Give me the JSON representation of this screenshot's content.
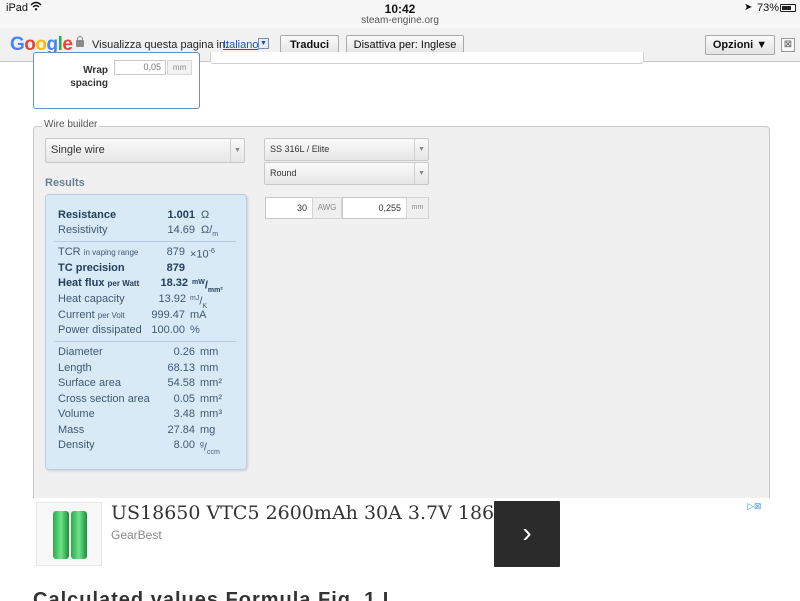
{
  "status_bar": {
    "device": "iPad",
    "time": "10:42",
    "url": "steam-engine.org",
    "battery": "73%",
    "battery_level": 0.73,
    "icons": [
      "wifi-icon",
      "location-arrow-icon",
      "battery-icon"
    ]
  },
  "translate_bar": {
    "logo": [
      "G",
      "o",
      "o",
      "g",
      "l",
      "e"
    ],
    "prompt": "Visualizza questa pagina in:",
    "language": "Italiano",
    "translate_button": "Traduci",
    "disable_button": "Disattiva per: Inglese",
    "options_button": "Opzioni ▼",
    "close_glyph": "⊠"
  },
  "coil": {
    "wrap_label": "Wrap spacing",
    "wrap_value": "0,05",
    "wrap_unit": "mm"
  },
  "wire_builder": {
    "legend": "Wire builder",
    "wire_type": "Single wire",
    "material": "SS 316L / Elite",
    "profile": "Round",
    "gauge": "30",
    "gauge_unit": "AWG",
    "diameter": "0,255",
    "diameter_unit": "mm",
    "results_title": "Results"
  },
  "results": {
    "resistance": {
      "label": "Resistance",
      "value": "1.001",
      "unit": "Ω"
    },
    "resistivity": {
      "label": "Resistivity",
      "value": "14.69"
    },
    "tcr": {
      "label": "TCR",
      "label_small": "in vaping range",
      "value": "879",
      "unit": "×10",
      "unit_sup": "-6"
    },
    "tc_precision": {
      "label": "TC precision",
      "value": "879"
    },
    "heat_flux": {
      "label": "Heat flux",
      "label_small": "per Watt",
      "value": "18.32"
    },
    "heat_capacity": {
      "label": "Heat capacity",
      "value": "13.92"
    },
    "current": {
      "label": "Current",
      "label_small": "per Volt",
      "value": "999.47",
      "unit": "mA"
    },
    "power": {
      "label": "Power dissipated",
      "value": "100.00",
      "unit": "%"
    },
    "diameter": {
      "label": "Diameter",
      "value": "0.26",
      "unit": "mm"
    },
    "length": {
      "label": "Length",
      "value": "68.13",
      "unit": "mm"
    },
    "surface": {
      "label": "Surface area",
      "value": "54.58",
      "unit": "mm²"
    },
    "cross": {
      "label": "Cross section area",
      "value": "0.05",
      "unit": "mm²"
    },
    "volume": {
      "label": "Volume",
      "value": "3.48",
      "unit": "mm³"
    },
    "mass": {
      "label": "Mass",
      "value": "27.84",
      "unit": "mg"
    },
    "density": {
      "label": "Density",
      "value": "8.00"
    }
  },
  "ad": {
    "title": "US18650 VTC5 2600mAh 30A 3.7V 18650...",
    "brand": "GearBest",
    "button_glyph": "›",
    "choice_glyph": "▷⊠"
  },
  "cut_text": "Calculated  values  Formula                    Fig. 1 L ..."
}
